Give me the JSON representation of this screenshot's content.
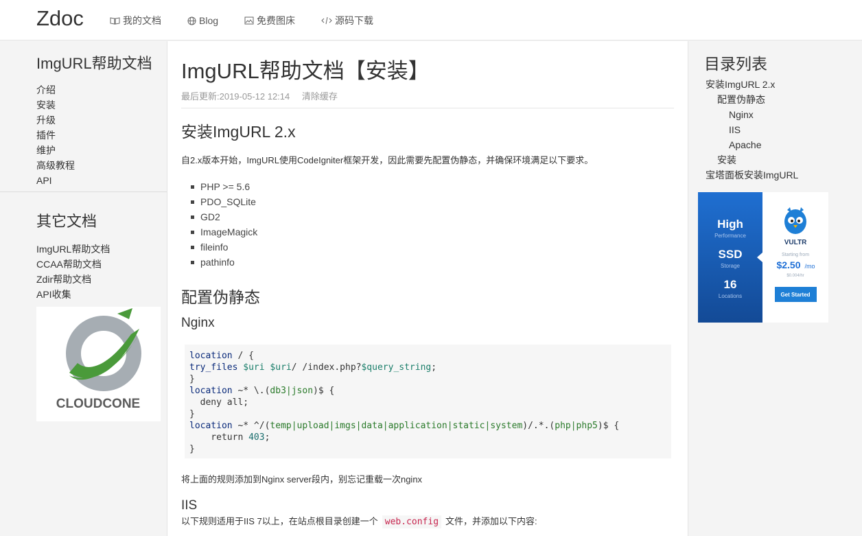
{
  "brand": "Zdoc",
  "nav": [
    {
      "label": "我的文档",
      "icon": "book-icon"
    },
    {
      "label": "Blog",
      "icon": "globe-icon"
    },
    {
      "label": "免费图床",
      "icon": "image-icon"
    },
    {
      "label": "源码下载",
      "icon": "code-icon"
    }
  ],
  "sidebar": {
    "title": "ImgURL帮助文档",
    "items": [
      "介绍",
      "安装",
      "升级",
      "插件",
      "维护",
      "高级教程",
      "API"
    ],
    "other_title": "其它文档",
    "other_items": [
      "ImgURL帮助文档",
      "CCAA帮助文档",
      "Zdir帮助文档",
      "API收集"
    ],
    "ad_label": "CLOUDCONE"
  },
  "main": {
    "title": "ImgURL帮助文档【安装】",
    "updated": "最后更新:2019-05-12 12:14",
    "clear_cache": "清除缓存",
    "h_install": "安装ImgURL 2.x",
    "intro": "自2.x版本开始，ImgURL使用CodeIgniter框架开发，因此需要先配置伪静态，并确保环境满足以下要求。",
    "requirements": [
      "PHP >= 5.6",
      "PDO_SQLite",
      "GD2",
      "ImageMagick",
      "fileinfo",
      "pathinfo"
    ],
    "h_rewrite": "配置伪静态",
    "h_nginx": "Nginx",
    "nginx_note": "将上面的规则添加到Nginx server段内，别忘记重载一次nginx",
    "h_iis": "IIS",
    "iis_note_before": "以下规则适用于IIS 7以上，在站点根目录创建一个",
    "iis_code": "web.config",
    "iis_note_after": "文件，并添加以下内容:"
  },
  "toc": {
    "title": "目录列表",
    "items": [
      {
        "label": "安装ImgURL 2.x",
        "level": 1
      },
      {
        "label": "配置伪静态",
        "level": 2
      },
      {
        "label": "Nginx",
        "level": 3
      },
      {
        "label": "IIS",
        "level": 3
      },
      {
        "label": "Apache",
        "level": 3
      },
      {
        "label": "安装",
        "level": 2
      },
      {
        "label": "宝塔面板安装ImgURL",
        "level": 1
      }
    ]
  },
  "vultr_ad": {
    "high": "High",
    "performance": "Performance",
    "ssd": "SSD",
    "storage": "Storage",
    "locations_count": "16",
    "locations": "Locations",
    "brand": "VULTR",
    "starting_from": "Starting from",
    "price": "$2.50",
    "per": "/mo",
    "hourly": "$0.004/hr",
    "cta": "Get Started"
  },
  "colors": {
    "vultr_blue": "#1e63c3",
    "cloudcone_green": "#4a9a3a"
  }
}
